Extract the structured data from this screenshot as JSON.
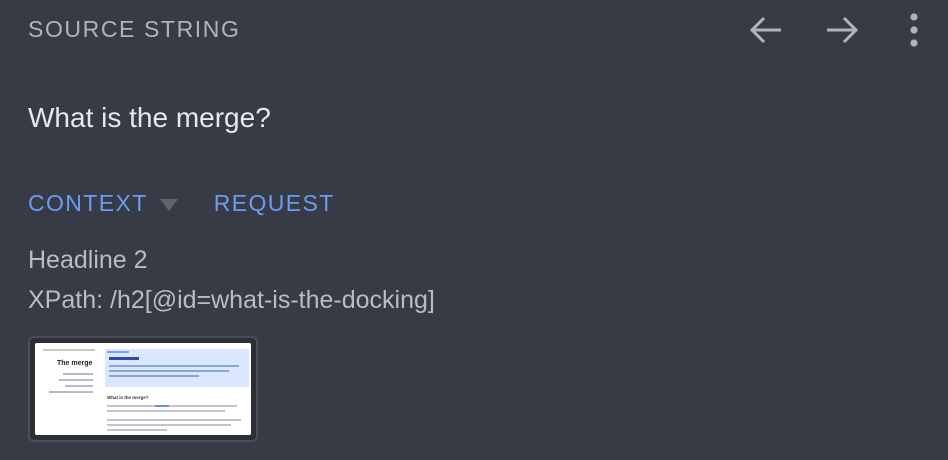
{
  "header": {
    "title": "SOURCE STRING"
  },
  "toolbar": {
    "back_icon": "arrow-left-icon",
    "forward_icon": "arrow-right-icon",
    "menu_icon": "more-vertical-icon"
  },
  "source": {
    "text": "What is the merge?"
  },
  "tabs": [
    {
      "label": "CONTEXT"
    },
    {
      "label": "REQUEST"
    }
  ],
  "context": {
    "element_type": "Headline 2",
    "xpath": "XPath: /h2[@id=what-is-the-docking]"
  },
  "screenshot_thumbnail": {
    "page_title": "The merge",
    "heading": "What is the merge?"
  },
  "colors": {
    "background": "#373b45",
    "accent": "#6b9cf0",
    "muted_text": "#aeb3bc",
    "primary_text": "#e6e8ec"
  }
}
